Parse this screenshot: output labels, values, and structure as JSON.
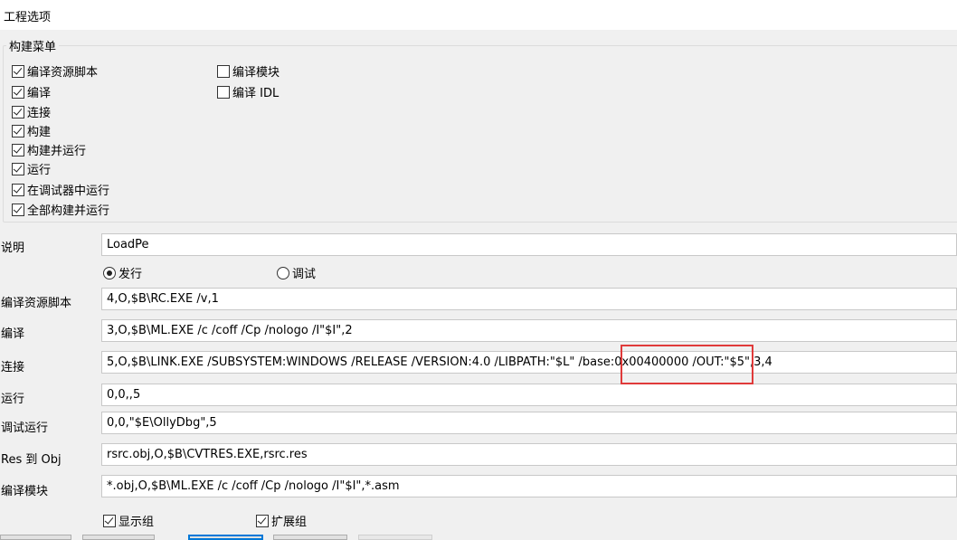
{
  "window": {
    "title": "工程选项"
  },
  "build_menu": {
    "legend": "构建菜单",
    "items": [
      {
        "label": "编译资源脚本",
        "checked": true
      },
      {
        "label": "编译",
        "checked": true
      },
      {
        "label": "连接",
        "checked": true
      },
      {
        "label": "构建",
        "checked": true
      },
      {
        "label": "构建并运行",
        "checked": true
      },
      {
        "label": "运行",
        "checked": true
      },
      {
        "label": "在调试器中运行",
        "checked": true
      },
      {
        "label": "全部构建并运行",
        "checked": true
      },
      {
        "label": "编译模块",
        "checked": false
      },
      {
        "label": "编译 IDL",
        "checked": false
      }
    ]
  },
  "description": {
    "label": "说明",
    "value": "LoadPe"
  },
  "mode": {
    "options": [
      {
        "label": "发行",
        "selected": true
      },
      {
        "label": "调试",
        "selected": false
      }
    ]
  },
  "commands": [
    {
      "label": "编译资源脚本",
      "value": "4,O,$B\\RC.EXE /v,1"
    },
    {
      "label": "编译",
      "value": "3,O,$B\\ML.EXE /c /coff /Cp /nologo /I\"$I\",2"
    },
    {
      "label": "连接",
      "value": "5,O,$B\\LINK.EXE /SUBSYSTEM:WINDOWS /RELEASE /VERSION:4.0 /LIBPATH:\"$L\" /base:0x00400000 /OUT:\"$5\",3,4"
    },
    {
      "label": "运行",
      "value": "0,0,,5"
    },
    {
      "label": "调试运行",
      "value": "0,0,\"$E\\OllyDbg\",5"
    },
    {
      "label": "Res 到 Obj",
      "value": "rsrc.obj,O,$B\\CVTRES.EXE,rsrc.res"
    },
    {
      "label": "编译模块",
      "value": "*.obj,O,$B\\ML.EXE /c /coff /Cp /nologo /I\"$I\",*.asm"
    }
  ],
  "footer_checks": [
    {
      "label": "显示组",
      "checked": true
    },
    {
      "label": "扩展组",
      "checked": true
    }
  ],
  "colors": {
    "highlight": "#e03a3a",
    "default_button": "#0078d7"
  }
}
